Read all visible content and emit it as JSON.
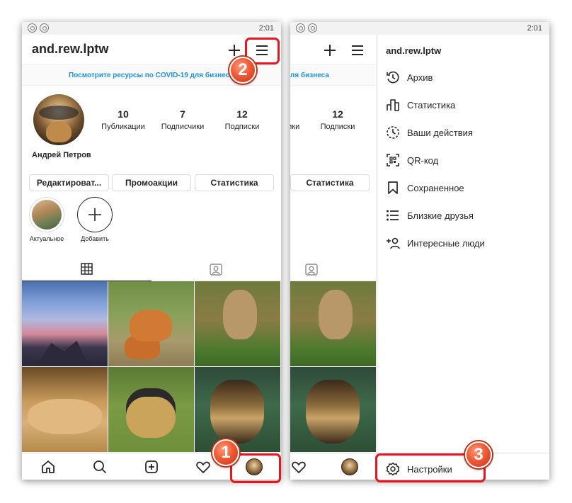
{
  "statusbar": {
    "time": "2:01"
  },
  "profile": {
    "username": "and.rew.lptw",
    "banner": "Посмотрите ресурсы по COVID-19 для бизнеса",
    "full_name": "Андрей Петров",
    "stats": [
      {
        "value": "10",
        "label": "Публикации"
      },
      {
        "value": "7",
        "label": "Подписчики"
      },
      {
        "value": "12",
        "label": "Подписки"
      }
    ],
    "buttons": {
      "edit": "Редактироват...",
      "promo": "Промоакции",
      "stats": "Статистика"
    },
    "highlights": {
      "current": "Актуальное",
      "add": "Добавить"
    }
  },
  "drawer": {
    "username": "and.rew.lptw",
    "items": [
      {
        "label": "Архив",
        "icon": "archive-icon"
      },
      {
        "label": "Статистика",
        "icon": "insights-icon"
      },
      {
        "label": "Ваши действия",
        "icon": "activity-icon"
      },
      {
        "label": "QR-код",
        "icon": "qr-code-icon"
      },
      {
        "label": "Сохраненное",
        "icon": "bookmark-icon"
      },
      {
        "label": "Близкие друзья",
        "icon": "close-friends-icon"
      },
      {
        "label": "Интересные люди",
        "icon": "discover-people-icon"
      }
    ],
    "settings": "Настройки"
  },
  "annotations": {
    "step1": "1",
    "step2": "2",
    "step3": "3",
    "color": "#e8141e"
  }
}
